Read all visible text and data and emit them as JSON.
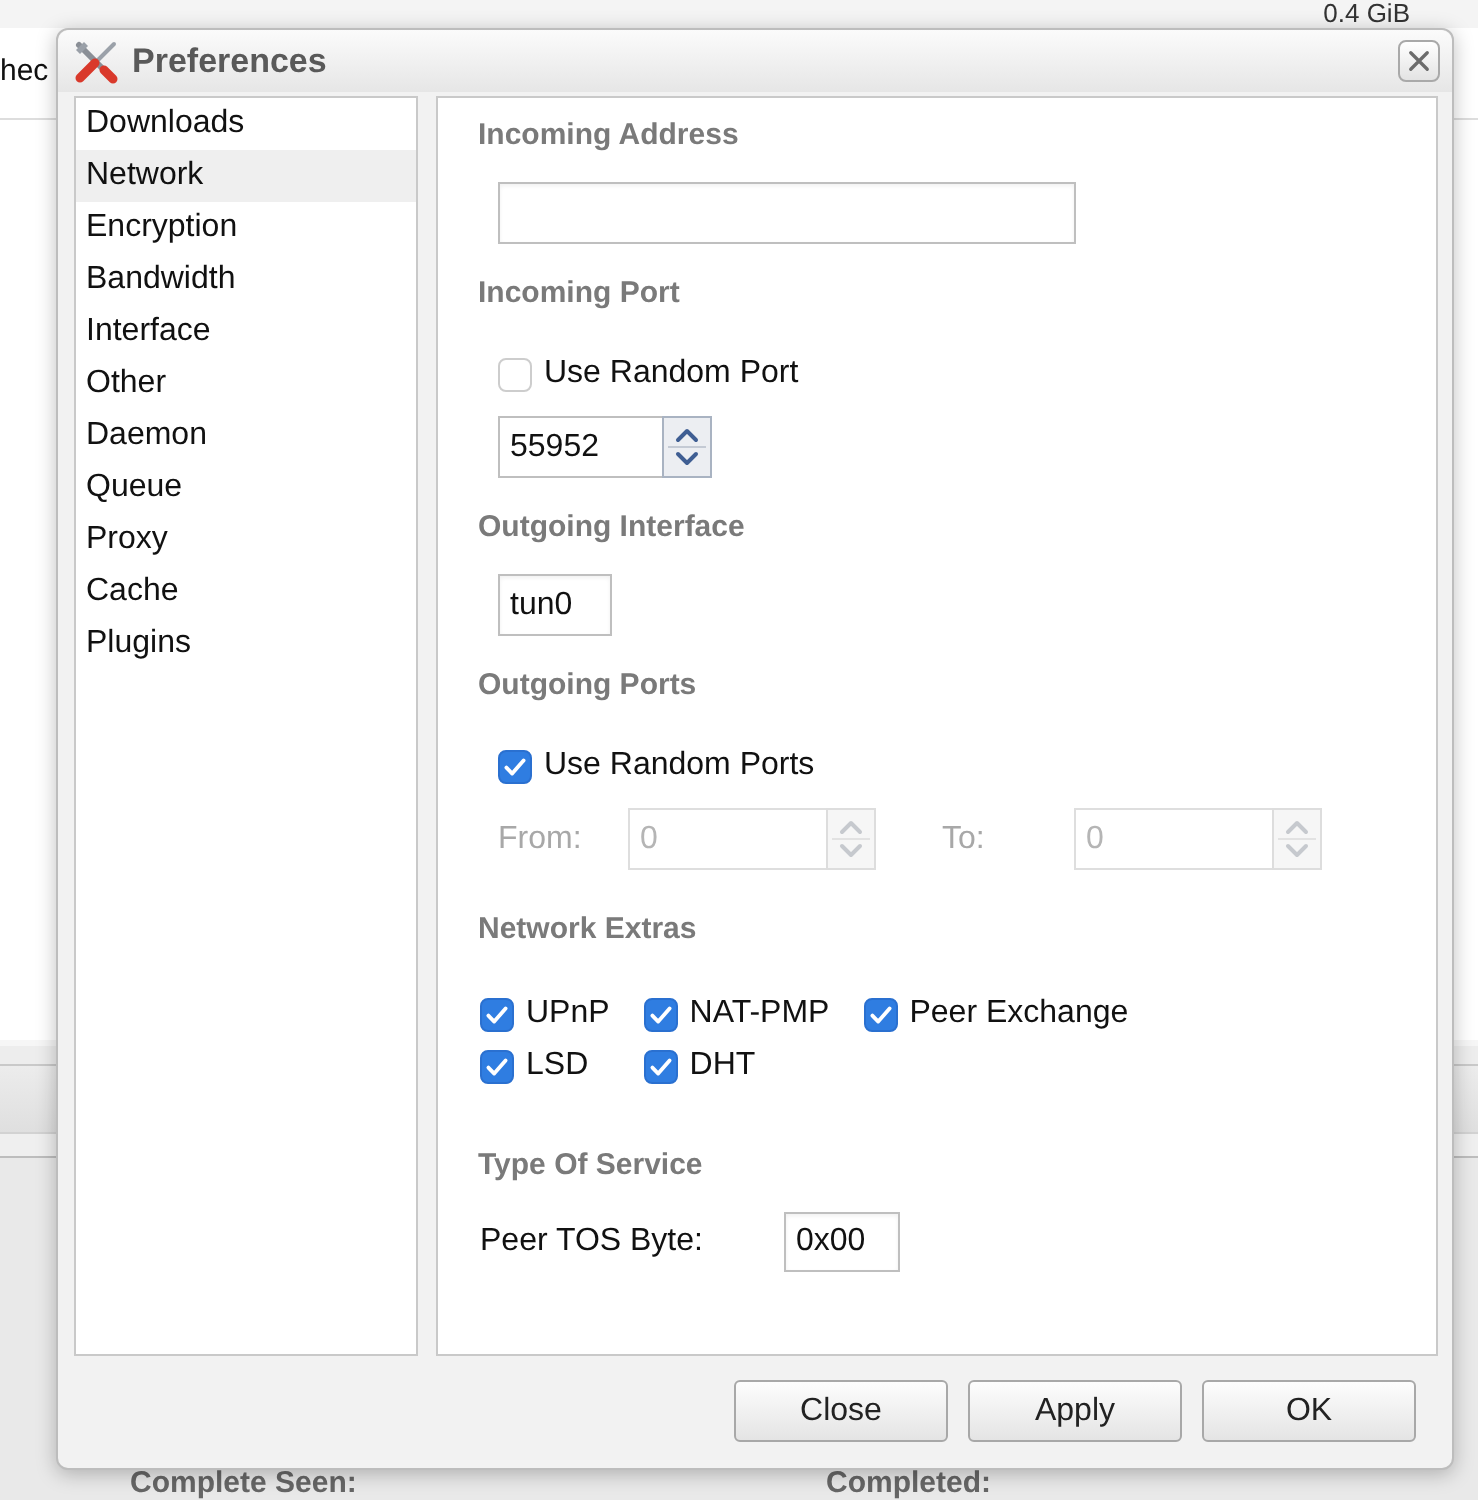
{
  "background": {
    "size_text": "0.4 GiB",
    "toolbar_text": "hec",
    "detail_labels": [
      "Complete Seen:",
      "Completed:"
    ]
  },
  "dialog": {
    "title": "Preferences"
  },
  "sidebar": {
    "items": [
      {
        "label": "Downloads",
        "selected": false
      },
      {
        "label": "Network",
        "selected": true
      },
      {
        "label": "Encryption",
        "selected": false
      },
      {
        "label": "Bandwidth",
        "selected": false
      },
      {
        "label": "Interface",
        "selected": false
      },
      {
        "label": "Other",
        "selected": false
      },
      {
        "label": "Daemon",
        "selected": false
      },
      {
        "label": "Queue",
        "selected": false
      },
      {
        "label": "Proxy",
        "selected": false
      },
      {
        "label": "Cache",
        "selected": false
      },
      {
        "label": "Plugins",
        "selected": false
      }
    ]
  },
  "sections": [
    {
      "heading": "Incoming Address",
      "controls": [
        {
          "kind": "address_field"
        }
      ]
    },
    {
      "heading": "Incoming Port",
      "controls": [
        {
          "kind": "checkbox",
          "label": "Use Random Port",
          "checked": false
        },
        {
          "kind": "spinner",
          "value": "55952",
          "disabled": false
        }
      ]
    },
    {
      "heading": "Outgoing Interface",
      "controls": [
        {
          "kind": "text_field",
          "value": "tun0"
        }
      ]
    },
    {
      "heading": "Outgoing Ports",
      "controls": [
        {
          "kind": "checkbox",
          "label": "Use Random Ports",
          "checked": true
        },
        {
          "kind": "port_range",
          "disabled": true,
          "from_label": "From:",
          "from_value": "0",
          "to_label": "To:",
          "to_value": "0"
        }
      ]
    },
    {
      "heading": "Network Extras",
      "controls": [
        {
          "kind": "checkbox_grid",
          "items": [
            {
              "label": "UPnP",
              "checked": true
            },
            {
              "label": "NAT-PMP",
              "checked": true
            },
            {
              "label": "Peer Exchange",
              "checked": true
            },
            {
              "label": "LSD",
              "checked": true
            },
            {
              "label": "DHT",
              "checked": true
            }
          ]
        }
      ]
    },
    {
      "heading": "Type Of Service",
      "controls": [
        {
          "kind": "labeled_field",
          "label": "Peer TOS Byte:",
          "value": "0x00"
        }
      ]
    }
  ],
  "buttons": [
    "Close",
    "Apply",
    "OK"
  ]
}
